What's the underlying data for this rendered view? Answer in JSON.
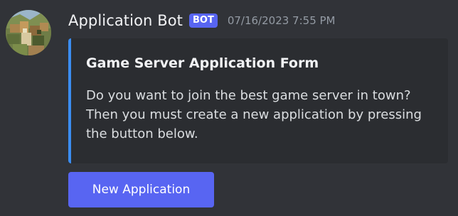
{
  "message": {
    "username": "Application Bot",
    "badge": "BOT",
    "timestamp": "07/16/2023 7:55 PM",
    "avatar_icon": "blocky-game-landscape-avatar"
  },
  "embed": {
    "accent_color": "#3b8df1",
    "title": "Game Server Application Form",
    "description_lines": [
      "Do you want to join the best game server in town?",
      "Then you must create a new application by pressing",
      "the button below."
    ]
  },
  "button": {
    "label": "New Application",
    "color": "#5865f2"
  },
  "colors": {
    "background": "#313338",
    "embed_background": "#2b2d31",
    "timestamp": "#949ba4"
  }
}
